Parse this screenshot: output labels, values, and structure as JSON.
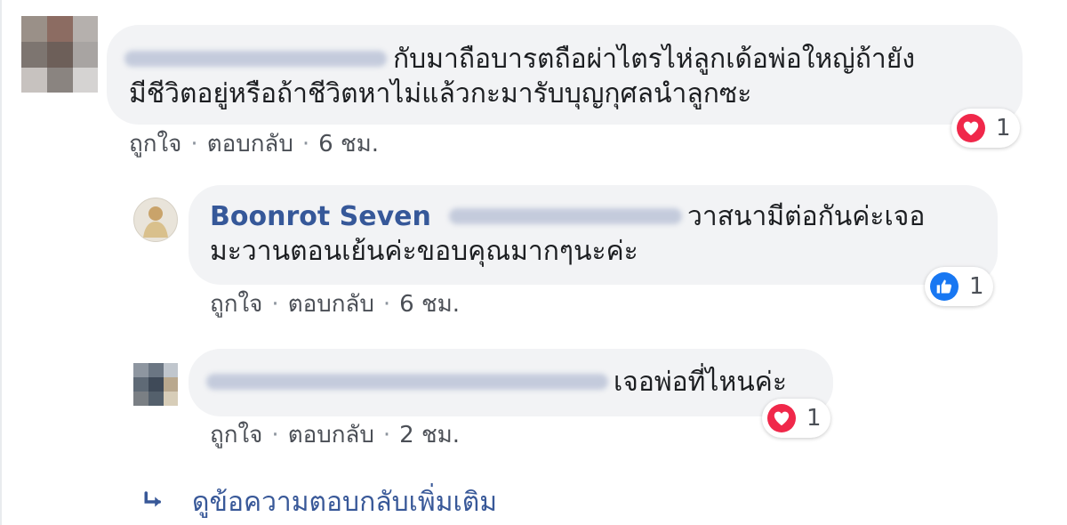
{
  "comments": [
    {
      "author_name": "",
      "text_line1": "กับมาถือบารตถือผ่าไตรไห่ลูกเด้อพ่อใหญ่ถ้ายัง",
      "text_line2": "มีชีวิตอยู่หรือถ้าชีวิตหาไม่แล้วกะมารับบุญกุศลนำลูกซะ",
      "like_label": "ถูกใจ",
      "reply_label": "ตอบกลับ",
      "separator": "·",
      "time": "6 ชม.",
      "reaction_icon": "love-icon",
      "reaction_count": "1"
    },
    {
      "author_name": "Boonrot Seven",
      "text_line1": "วาสนามีต่อกันค่ะเจอ",
      "text_line2": "มะวานตอนเย้นค่ะขอบคุณมากๆนะค่ะ",
      "like_label": "ถูกใจ",
      "reply_label": "ตอบกลับ",
      "separator": "·",
      "time": "6 ชม.",
      "reaction_icon": "like-icon",
      "reaction_count": "1"
    },
    {
      "author_name": "",
      "text_line1": "เจอพ่อที่ไหนค่ะ",
      "like_label": "ถูกใจ",
      "reply_label": "ตอบกลับ",
      "separator": "·",
      "time": "2 ชม.",
      "reaction_icon": "love-icon",
      "reaction_count": "1"
    }
  ],
  "more_replies": {
    "label": "ดูข้อความตอบกลับเพิ่มเติม",
    "icon": "reply-arrow-icon"
  },
  "colors": {
    "bubble": "#f2f3f5",
    "name": "#365899",
    "link": "#385898",
    "meta": "#4b4f56",
    "love": "#f0284a",
    "like": "#1877f2"
  }
}
